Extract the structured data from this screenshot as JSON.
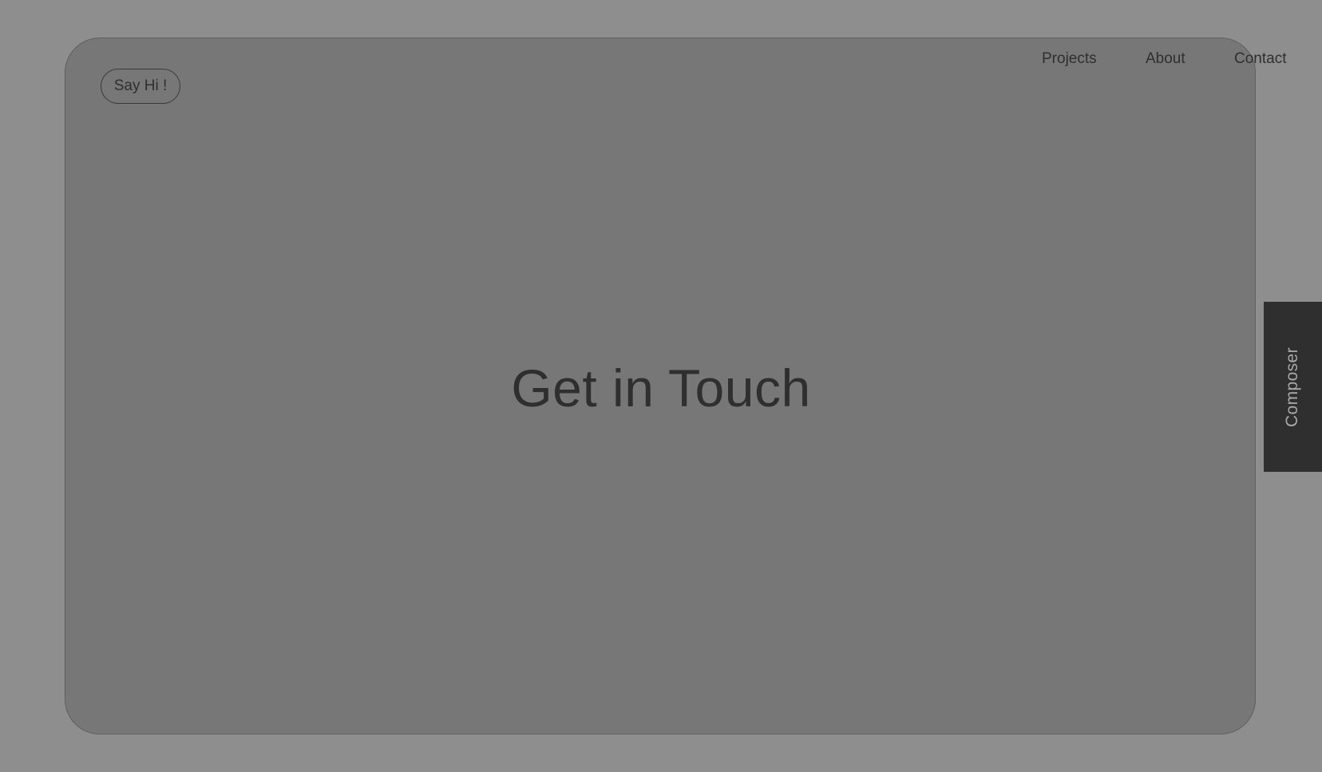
{
  "header": {
    "say_hi_label": "Say Hi !",
    "nav": {
      "projects": "Projects",
      "about": "About",
      "contact": "Contact"
    }
  },
  "main": {
    "headline": "Get in Touch"
  },
  "side_tab": {
    "label": "Composer"
  },
  "colors": {
    "background": "#8e8e8e",
    "card": "#777777",
    "text": "#2f2f2f",
    "side_tab": "#2f2f2f",
    "side_tab_text": "#a9a9a9"
  }
}
